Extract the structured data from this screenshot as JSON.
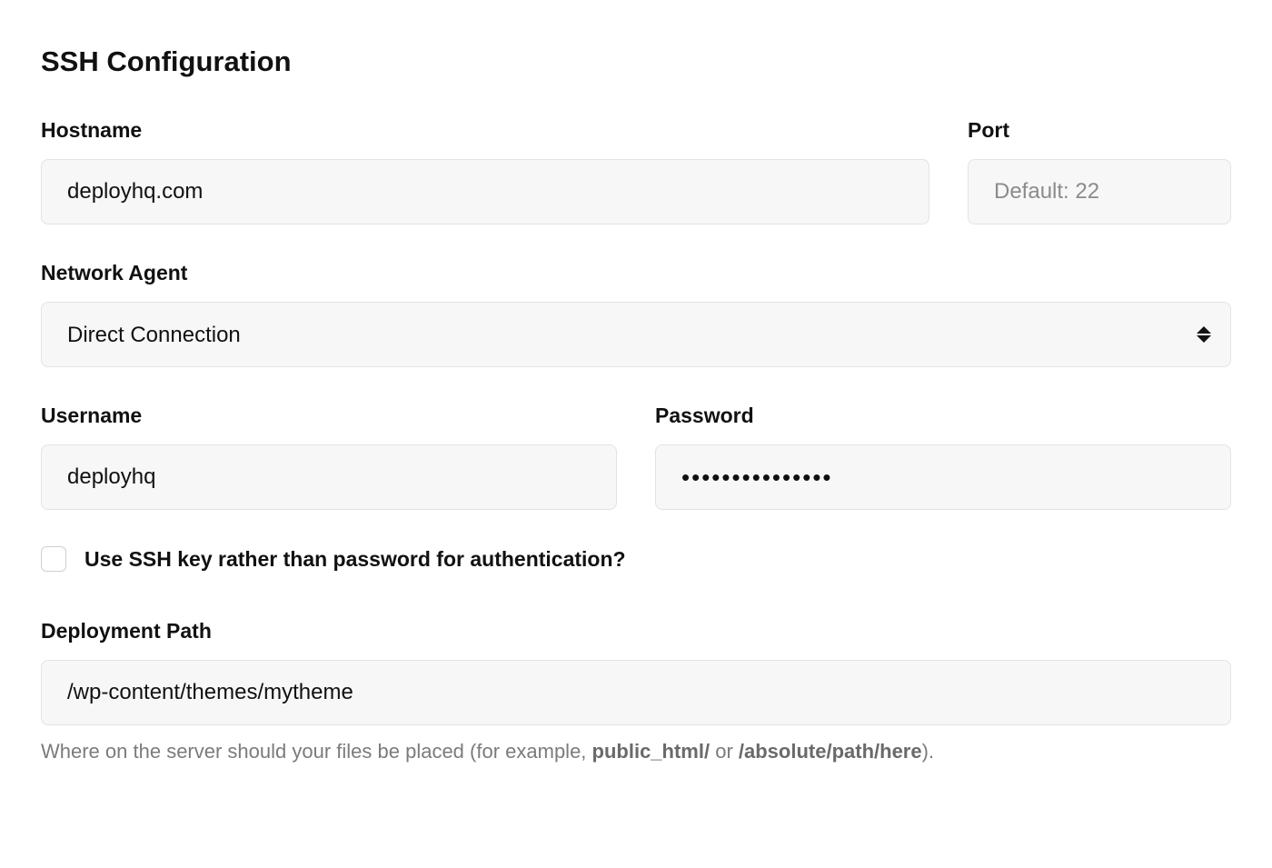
{
  "section_title": "SSH Configuration",
  "hostname": {
    "label": "Hostname",
    "value": "deployhq.com"
  },
  "port": {
    "label": "Port",
    "placeholder": "Default: 22",
    "value": ""
  },
  "network_agent": {
    "label": "Network Agent",
    "selected": "Direct Connection"
  },
  "username": {
    "label": "Username",
    "value": "deployhq"
  },
  "password": {
    "label": "Password",
    "value": "•••••••••••••••"
  },
  "ssh_key_checkbox": {
    "label": "Use SSH key rather than password for authentication?",
    "checked": false
  },
  "deployment_path": {
    "label": "Deployment Path",
    "value": "/wp-content/themes/mytheme",
    "help_prefix": "Where on the server should your files be placed (for example, ",
    "help_example1": "public_html/",
    "help_middle": " or ",
    "help_example2": "/absolute/path/here",
    "help_suffix": ")."
  }
}
